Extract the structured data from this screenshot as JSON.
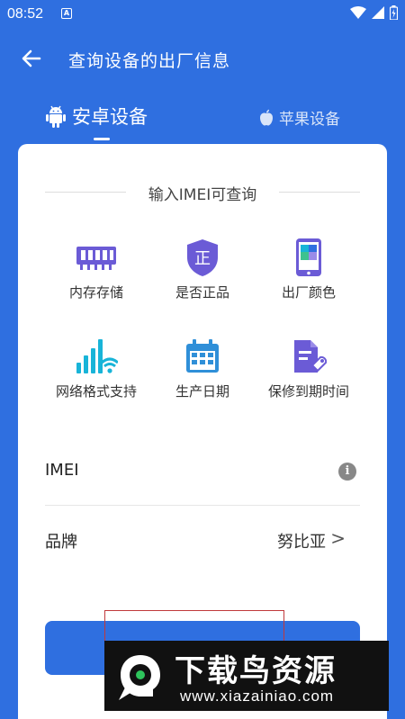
{
  "status": {
    "time": "08:52",
    "notif_letter": "A"
  },
  "appbar": {
    "title": "查询设备的出厂信息"
  },
  "tabs": {
    "android": "安卓设备",
    "apple": "苹果设备"
  },
  "section": {
    "title": "输入IMEI可查询"
  },
  "features": [
    {
      "label": "内存存储",
      "icon": "memory-chip-icon"
    },
    {
      "label": "是否正品",
      "icon": "genuine-shield-icon",
      "glyph": "正"
    },
    {
      "label": "出厂颜色",
      "icon": "phone-color-icon"
    },
    {
      "label": "网络格式支持",
      "icon": "signal-wifi-icon"
    },
    {
      "label": "生产日期",
      "icon": "calendar-icon"
    },
    {
      "label": "保修到期时间",
      "icon": "warranty-doc-icon"
    }
  ],
  "form": {
    "imei_label": "IMEI",
    "brand_label": "品牌",
    "brand_value": "努比亚",
    "chevron": ">"
  },
  "watermark": {
    "title": "下载鸟资源",
    "url": "www.xiazainiao.com"
  },
  "colors": {
    "primary": "#2f6fe0",
    "purple": "#6b5bd6",
    "cyan": "#18b4d8"
  }
}
